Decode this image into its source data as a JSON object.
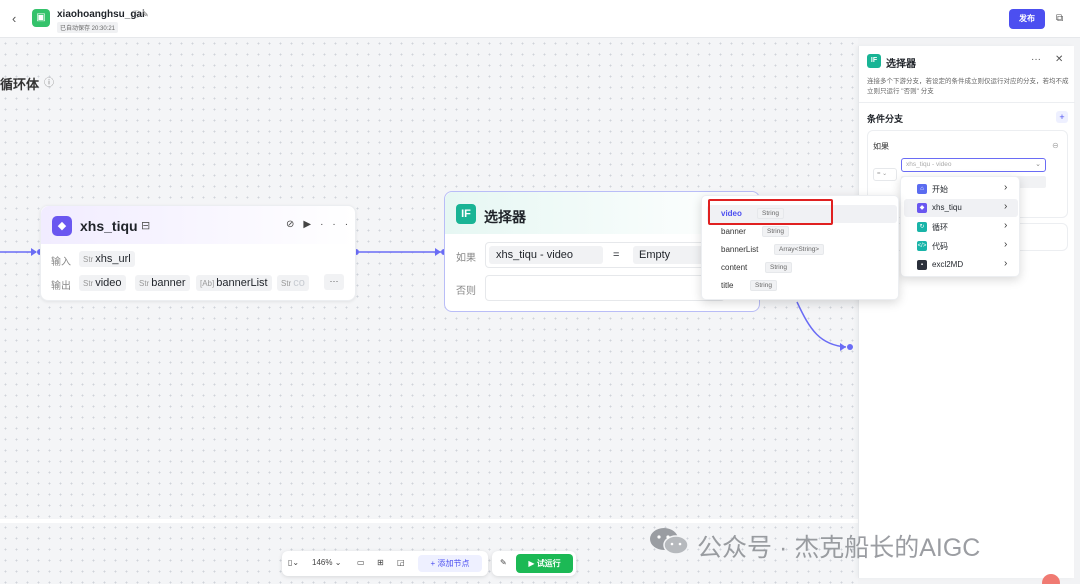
{
  "header": {
    "back_icon": "chevron-left-icon",
    "app_name": "xiaohoanghsu_gai",
    "save_status": "已自动保存 20:30:21",
    "publish_label": "发布"
  },
  "canvas": {
    "title": "循环体"
  },
  "node_xhs": {
    "title": "xhs_tiqu",
    "input_label": "输入",
    "output_label": "输出",
    "inputs": [
      {
        "type": "Str",
        "name": "xhs_url"
      }
    ],
    "outputs": [
      {
        "type": "Str",
        "name": "video"
      },
      {
        "type": "Str",
        "name": "banner"
      },
      {
        "type": "[Ab]",
        "name": "bannerList"
      },
      {
        "type": "Str",
        "name": "co"
      }
    ],
    "more_label": "···"
  },
  "node_selector": {
    "icon_text": "IF",
    "title": "选择器",
    "if_label": "如果",
    "else_label": "否则",
    "cond_var": "xhs_tiqu  -  video",
    "cond_op": "=",
    "cond_value": "Empty"
  },
  "panel": {
    "icon_text": "IF",
    "title": "选择器",
    "description": "连接多个下游分支，若设定的条件成立则仅运行对应的分支，若均不成立则只运行 \"否则\" 分支",
    "section_title": "条件分支",
    "if_label": "如果",
    "op_label": "=",
    "select_placeholder": "xhs_tiqu - video"
  },
  "source_menu": [
    {
      "label": "开始",
      "color": "#5b6cf0"
    },
    {
      "label": "xhs_tiqu",
      "color": "#6a57f0"
    },
    {
      "label": "循环",
      "color": "#19b4a8"
    },
    {
      "label": "代码",
      "color": "#19b4a8"
    },
    {
      "label": "excl2MD",
      "color": "#2a2f3a"
    }
  ],
  "field_menu": [
    {
      "name": "video",
      "type": "String"
    },
    {
      "name": "banner",
      "type": "String"
    },
    {
      "name": "bannerList",
      "type": "Array<String>"
    },
    {
      "name": "content",
      "type": "String"
    },
    {
      "name": "title",
      "type": "String"
    }
  ],
  "toolbar": {
    "zoom": "146%",
    "add_node_label": "添加节点",
    "run_label": "试运行"
  },
  "watermark": "公众号 · 杰克船长的AIGC",
  "colors": {
    "accent": "#4c4ff0",
    "green": "#1cb955",
    "teal": "#19b495",
    "highlight": "#e02020"
  }
}
